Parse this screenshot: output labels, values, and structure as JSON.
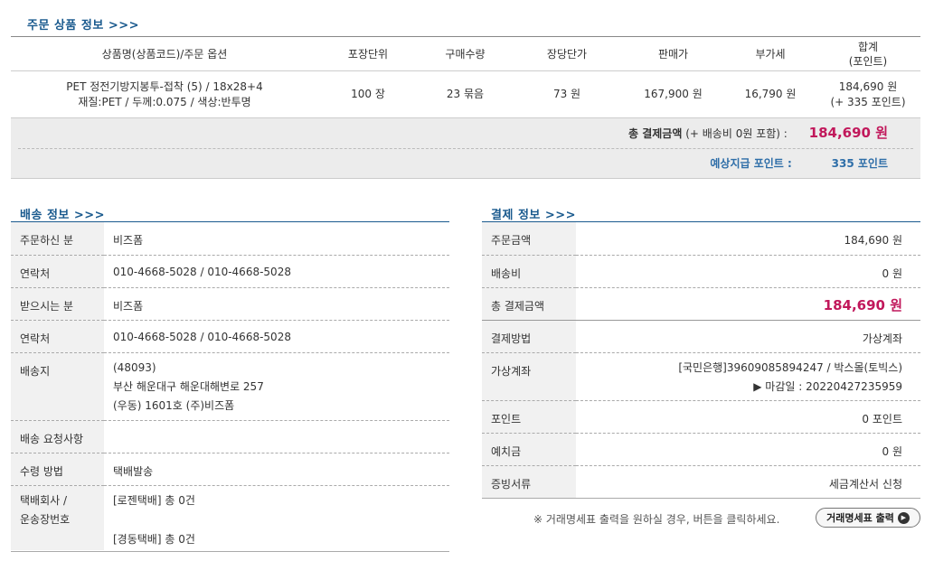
{
  "order_items": {
    "section_title": "주문 상품 정보 >>>",
    "columns": [
      "상품명(상품코드)/주문 옵션",
      "포장단위",
      "구매수량",
      "장당단가",
      "판매가",
      "부가세",
      "합계",
      "(포인트)"
    ],
    "rows": [
      {
        "name_line1": "PET 정전기방지봉투-접착 (5) / 18x28+4",
        "name_line2": "재질:PET / 두께:0.075 / 색상:반투명",
        "unit": "100 장",
        "qty": "23 묶음",
        "unit_price": "73 원",
        "sale_price": "167,900 원",
        "vat": "16,790 원",
        "total": "184,690 원",
        "points": "(+ 335 포인트)"
      }
    ]
  },
  "order_total": {
    "label": "총 결제금액",
    "shipping_note": "(+ 배송비 0원 포함) :",
    "amount": "184,690 원",
    "points_label": "예상지급 포인트 :",
    "points_value": "335 포인트"
  },
  "shipping": {
    "section_title": "배송 정보 >>>",
    "orderer_label": "주문하신 분",
    "orderer": "비즈폼",
    "orderer_phone_label": "연락처",
    "orderer_phone": "010-4668-5028 / 010-4668-5028",
    "recipient_label": "받으시는 분",
    "recipient": "비즈폼",
    "recipient_phone_label": "연락처",
    "recipient_phone": "010-4668-5028 / 010-4668-5028",
    "address_label": "배송지",
    "address_zip": "(48093)",
    "address_line1": "부산 해운대구 해운대해변로 257",
    "address_line2": "(우동) 1601호 (주)비즈폼",
    "request_label": "배송 요청사항",
    "request": "",
    "method_label": "수령 방법",
    "method": "택배발송",
    "courier_label_1": "택배회사 /",
    "courier_label_2": "운송장번호",
    "courier_1": "[로젠택배] 총 0건",
    "courier_2": "[경동택배] 총 0건"
  },
  "payment": {
    "section_title": "결제 정보 >>>",
    "order_amount_label": "주문금액",
    "order_amount": "184,690 원",
    "shipping_fee_label": "배송비",
    "shipping_fee": "0 원",
    "total_label": "총 결제금액",
    "total": "184,690 원",
    "method_label": "결제방법",
    "method": "가상계좌",
    "account_label": "가상계좌",
    "account": "[국민은행]39609085894247 / 박스몰(토빅스)",
    "deadline": "▶ 마감일 : 20220427235959",
    "points_label": "포인트",
    "points": "0 포인트",
    "deposit_label": "예치금",
    "deposit": "0 원",
    "receipt_label": "증빙서류",
    "receipt": "세금계산서 신청"
  },
  "footer": {
    "notice": "※ 거래명세표 출력을 원하실 경우, 버튼을 클릭하세요.",
    "receipt_button": "거래명세표 출력"
  },
  "colors": {
    "accent_blue": "#1a5a8e",
    "price_red": "#c1185b",
    "label_bg": "#f1f1f1",
    "total_bg": "#ececec"
  }
}
